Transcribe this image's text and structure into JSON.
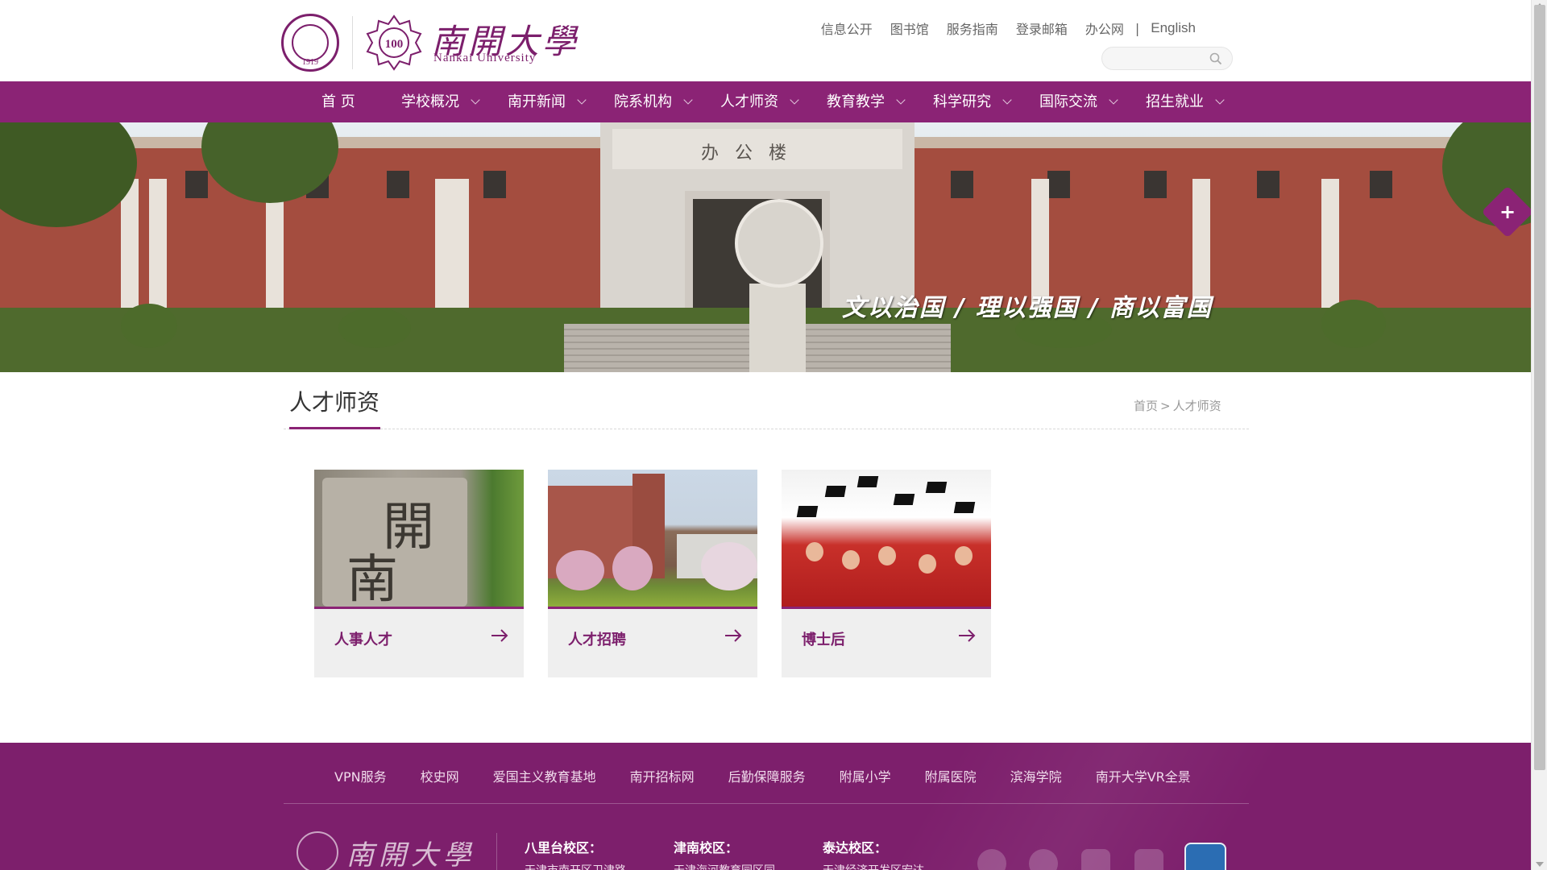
{
  "header": {
    "logo_year": "1919",
    "logo_badge": "100",
    "logo_cn": "南開大學",
    "logo_en": "Nankai University",
    "top_links": [
      "信息公开",
      "图书馆",
      "服务指南",
      "登录邮箱",
      "办公网"
    ],
    "separator": "|",
    "english": "English",
    "search_placeholder": ""
  },
  "nav": {
    "items": [
      "首 页",
      "学校概况",
      "南开新闻",
      "院系机构",
      "人才师资",
      "教育教学",
      "科学研究",
      "国际交流",
      "招生就业"
    ]
  },
  "banner": {
    "building_sign": "办公楼",
    "motto": "文以治国 / 理以强国 / 商以富国",
    "expand_symbol": "+"
  },
  "page": {
    "title": "人才师资",
    "breadcrumb": [
      "首页",
      "人才师资"
    ],
    "breadcrumb_sep": ">"
  },
  "cards": [
    {
      "label": "人事人才",
      "icon": "arrow-right-icon"
    },
    {
      "label": "人才招聘",
      "icon": "arrow-right-icon"
    },
    {
      "label": "博士后",
      "icon": "arrow-right-icon"
    }
  ],
  "footer": {
    "links": [
      "VPN服务",
      "校史网",
      "爱国主义教育基地",
      "南开招标网",
      "后勤保障服务",
      "附属小学",
      "附属医院",
      "滨海学院",
      "南开大学VR全景"
    ],
    "logo_cn": "南開大學",
    "campuses": [
      {
        "name": "八里台校区：",
        "address": "天津市南开区卫津路"
      },
      {
        "name": "津南校区：",
        "address": "天津海河教育园区同"
      },
      {
        "name": "泰达校区：",
        "address": "天津经济开发区宏达"
      }
    ],
    "social_icons": [
      "wechat-icon",
      "weibo-icon",
      "tiktok-icon",
      "bilibili-icon",
      "app-icon"
    ]
  },
  "colors": {
    "brand_purple": "#8b2375",
    "footer_purple": "#7d1f6c"
  }
}
